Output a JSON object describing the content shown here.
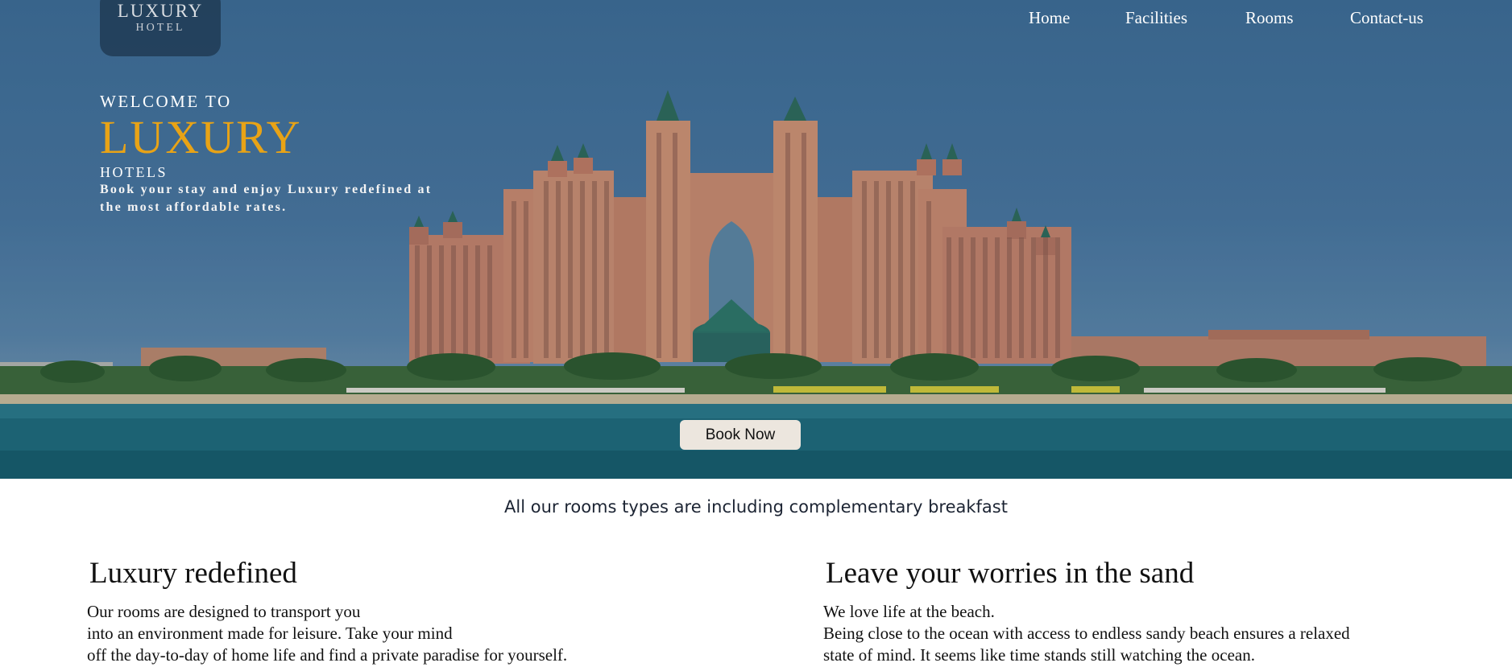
{
  "logo": {
    "name": "LUXURY",
    "sub": "HOTEL"
  },
  "nav": {
    "items": [
      "Home",
      "Facilities",
      "Rooms",
      "Contact-us"
    ]
  },
  "hero": {
    "welcome": "WELCOME TO",
    "brand": "LUXURY",
    "hotels": "HOTELS",
    "tagline": "Book your stay and enjoy Luxury redefined at the most affordable rates.",
    "book_button": "Book Now"
  },
  "notice": "All our rooms types are including complementary breakfast",
  "sections": [
    {
      "title": "Luxury redefined",
      "body": "Our rooms are designed to transport you\ninto an environment made for leisure. Take your mind\noff the day-to-day of home life and find a private paradise for yourself."
    },
    {
      "title": "Leave your worries in the sand",
      "body": "We love life at the beach.\nBeing close to the ocean with access to endless sandy beach ensures a relaxed\nstate of mind. It seems like time stands still watching the ocean."
    }
  ],
  "colors": {
    "accent": "#e8a316",
    "sky": "#45729b",
    "sea": "#1f6b7c",
    "button_bg": "#ece6de",
    "logo_bg": "#1e3750"
  }
}
